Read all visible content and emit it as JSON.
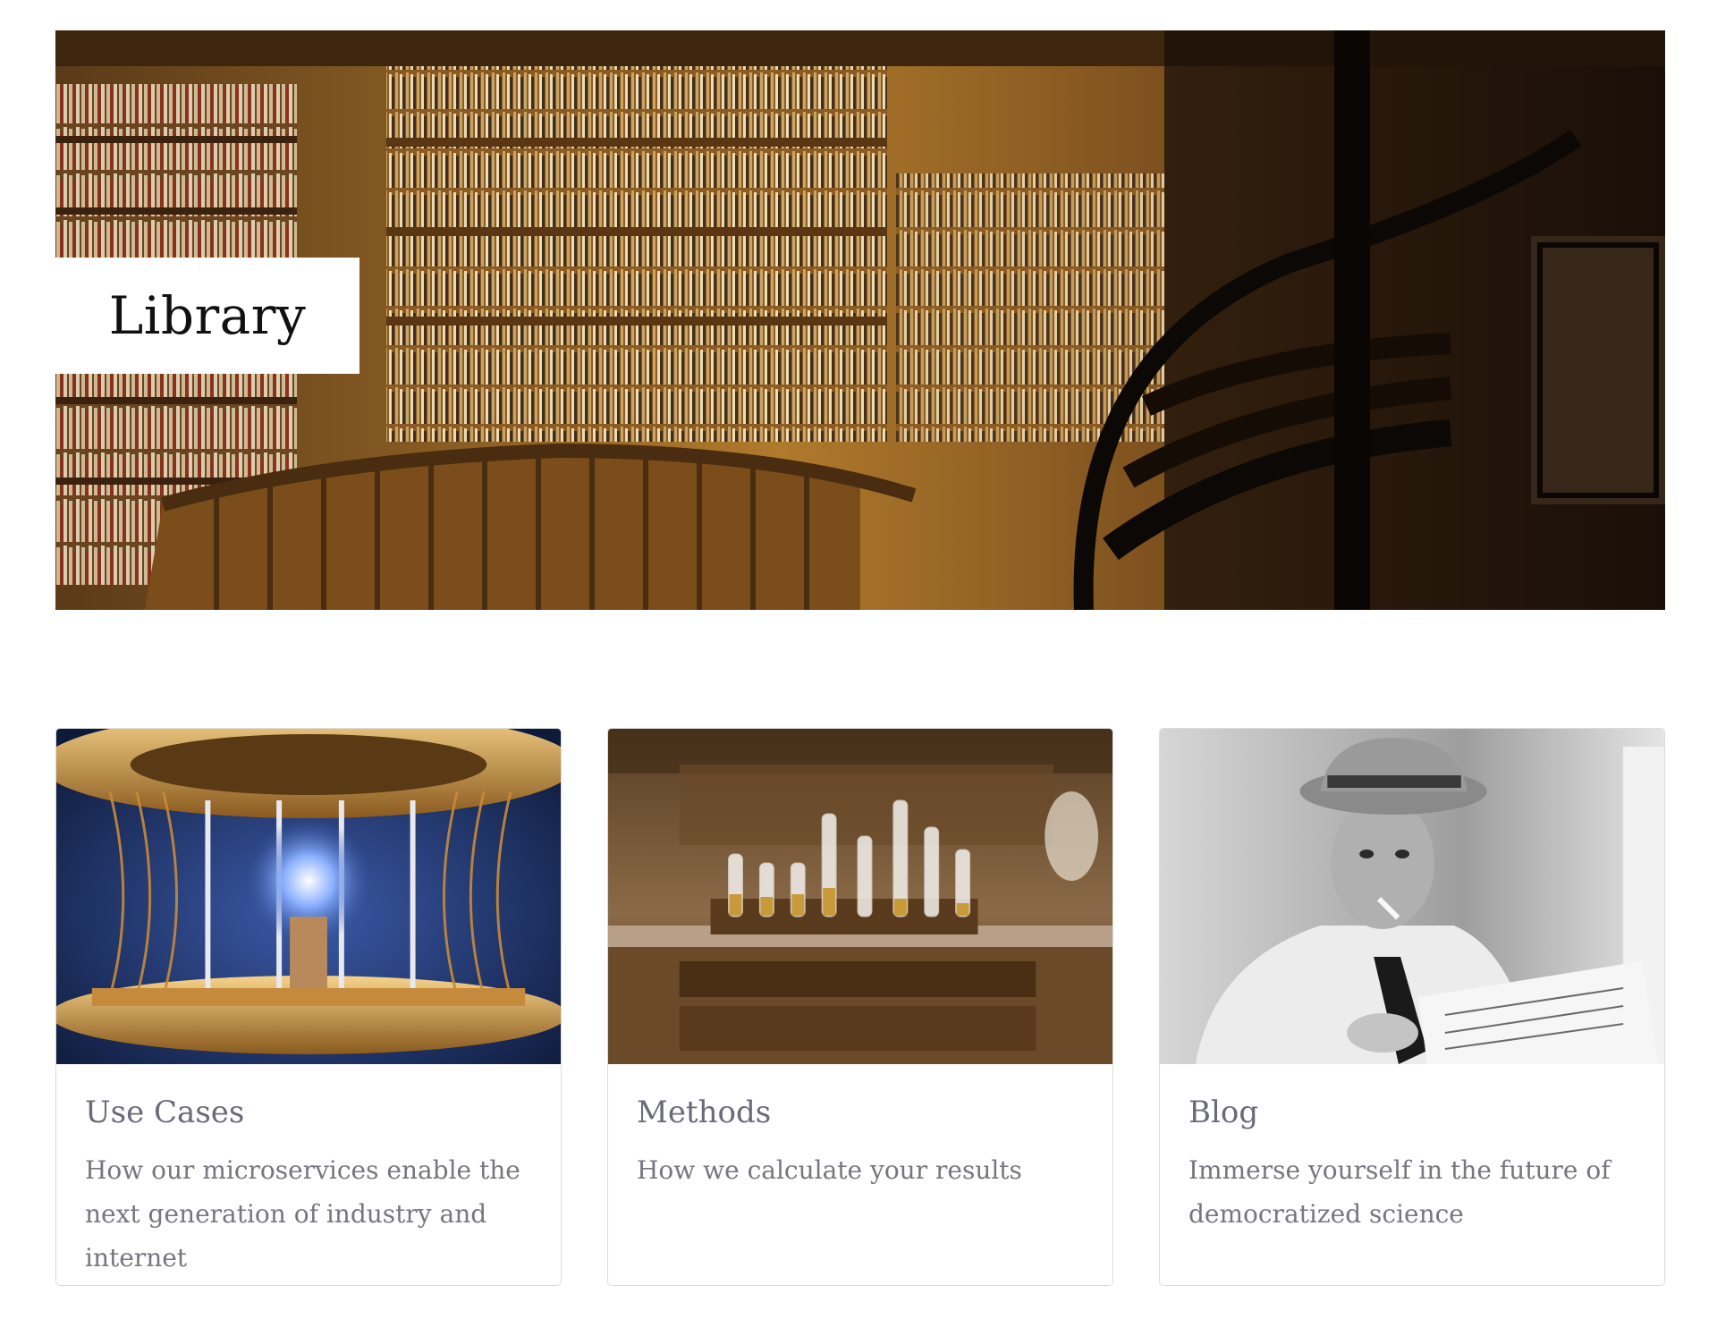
{
  "hero": {
    "title": "Library",
    "image_icon": "library-photo"
  },
  "cards": [
    {
      "title": "Use Cases",
      "description": "How our microservices enable the next generation of industry and internet",
      "image_icon": "quantum-computer-photo"
    },
    {
      "title": "Methods",
      "description": "How we calculate your results",
      "image_icon": "test-tubes-photo"
    },
    {
      "title": "Blog",
      "description": "Immerse yourself in the future of democratized science",
      "image_icon": "newspaper-reader-photo"
    }
  ],
  "colors": {
    "card_title": "#6a6a78",
    "card_text": "#77767f",
    "card_border": "#dcdcdc"
  }
}
